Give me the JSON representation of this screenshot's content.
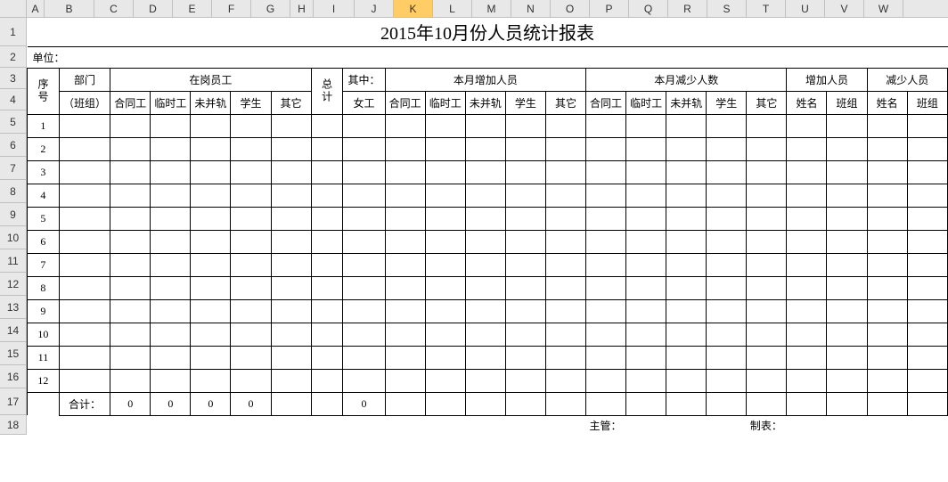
{
  "columns": [
    "A",
    "B",
    "C",
    "D",
    "E",
    "F",
    "G",
    "H",
    "I",
    "J",
    "K",
    "L",
    "M",
    "N",
    "O",
    "P",
    "Q",
    "R",
    "S",
    "T",
    "U",
    "V",
    "W"
  ],
  "selectedColumn": "K",
  "rowNumbers": [
    1,
    2,
    3,
    4,
    5,
    6,
    7,
    8,
    9,
    10,
    11,
    12,
    13,
    14,
    15,
    16,
    17,
    18
  ],
  "title": "2015年10月份人员统计报表",
  "unitLabel": "单位：",
  "headers": {
    "seq": "序号",
    "dept": "部门",
    "team": "（班组）",
    "onDuty": "在岗员工",
    "total": "总计",
    "ofWhich": "其中：",
    "female": "女工",
    "addThisMonth": "本月增加人员",
    "reduceThisMonth": "本月减少人数",
    "addPeople": "增加人员",
    "reducePeople": "减少人员",
    "contract": "合同工",
    "temp": "临时工",
    "unmerged": "未并轨",
    "student": "学生",
    "other": "其它",
    "name": "姓名",
    "group": "班组"
  },
  "dataRowNumbers": [
    1,
    2,
    3,
    4,
    5,
    6,
    7,
    8,
    9,
    10,
    11,
    12
  ],
  "totals": {
    "label": "合计：",
    "c": "0",
    "d": "0",
    "e": "0",
    "f": "0",
    "i": "0"
  },
  "footer": {
    "supervisor": "主管：",
    "preparer": "制表："
  },
  "colWidths": {
    "A": 20,
    "B": 56,
    "C": 44,
    "D": 44,
    "E": 44,
    "F": 44,
    "G": 44,
    "H": 26,
    "I": 46,
    "J": 44,
    "K": 44,
    "L": 44,
    "M": 44,
    "N": 44,
    "O": 44,
    "P": 44,
    "Q": 44,
    "R": 44,
    "S": 44,
    "T": 44,
    "U": 44,
    "V": 44,
    "W": 44
  },
  "rowHeights": {
    "1": 32,
    "2": 24,
    "3": 24,
    "4": 24,
    "5": 26,
    "6": 26,
    "7": 26,
    "8": 26,
    "9": 26,
    "10": 26,
    "11": 26,
    "12": 26,
    "13": 26,
    "14": 26,
    "15": 26,
    "16": 26,
    "17": 30,
    "18": 22
  }
}
